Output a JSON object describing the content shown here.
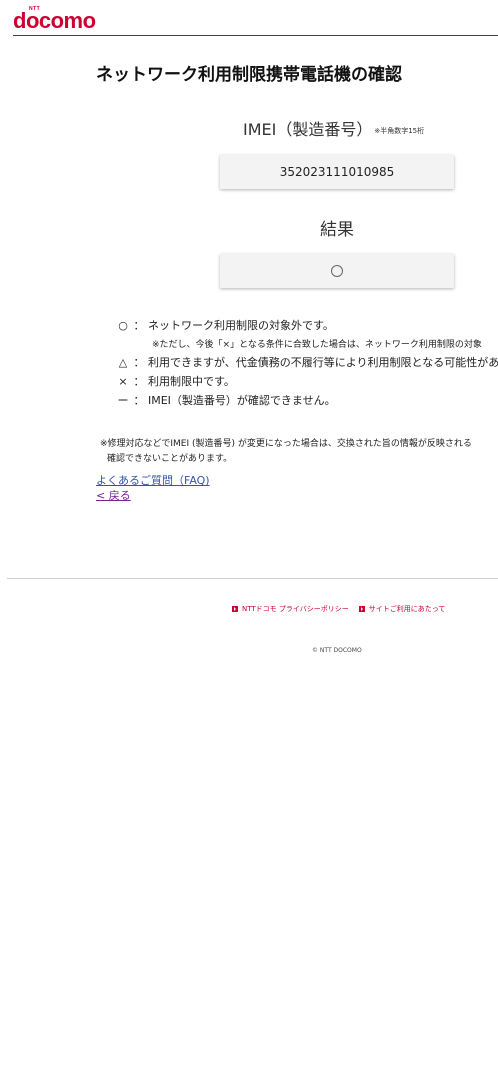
{
  "brand": {
    "ntt": "NTT",
    "name": "docomo"
  },
  "page_title": "ネットワーク利用制限携帯電話機の確認",
  "imei": {
    "label": "IMEI（製造番号）",
    "note": "※半角数字15桁",
    "value": "352023111010985"
  },
  "result": {
    "label": "結果",
    "value_symbol": "○"
  },
  "legend": [
    {
      "symbol": "○",
      "colon": "：",
      "text": "ネットワーク利用制限の対象外です。"
    },
    {
      "symbol": "△",
      "colon": "：",
      "text": "利用できますが、代金債務の不履行等により利用制限となる可能性があ"
    },
    {
      "symbol": "×",
      "colon": "：",
      "text": "利用制限中です。"
    },
    {
      "symbol": "ー",
      "colon": "：",
      "text": "IMEI（製造番号）が確認できません。"
    }
  ],
  "legend_subnote": "※ただし、今後「×」となる条件に合致した場合は、ネットワーク利用制限の対象",
  "footnote": {
    "line1": "※修理対応などでIMEI (製造番号) が変更になった場合は、交換された旨の情報が反映される",
    "line2": "確認できないことがあります。"
  },
  "links": {
    "faq": "よくあるご質問（FAQ)",
    "back": "< 戻る"
  },
  "footer": {
    "privacy": "NTTドコモ プライバシーポリシー",
    "terms": "サイトご利用にあたって",
    "copyright": "© NTT DOCOMO"
  },
  "colors": {
    "brand": "#cc0033",
    "link": "#3355aa",
    "visited_link": "#7a2299"
  }
}
